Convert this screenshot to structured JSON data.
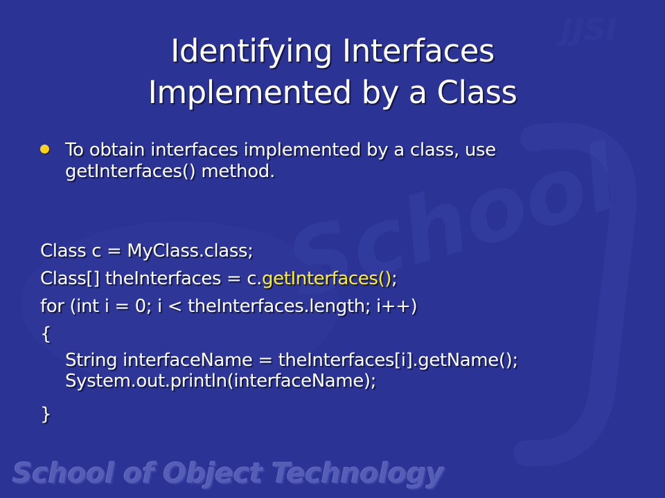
{
  "slide": {
    "title_lines": [
      "Identifying Interfaces",
      "Implemented by a Class"
    ],
    "bullet": {
      "lines": [
        "To obtain interfaces implemented by a class, use",
        "getInterfaces() method."
      ]
    },
    "code": {
      "line1": "Class c = MyClass.class;",
      "line2_prefix": "Class[] theInterfaces = c.",
      "line2_highlight": "getInterfaces()",
      "line2_suffix": ";",
      "line3": "for (int i = 0; i < theInterfaces.length; i++)",
      "line4": "{",
      "line5": "String interfaceName = theInterfaces[i].getName();",
      "line6": "System.out.println(interfaceName);",
      "line7": "}"
    },
    "footer": "School of Object Technology",
    "colors": {
      "background": "#2b3394",
      "text": "#ffffff",
      "bullet": "#ffd21a",
      "highlight": "#ffee22"
    }
  }
}
